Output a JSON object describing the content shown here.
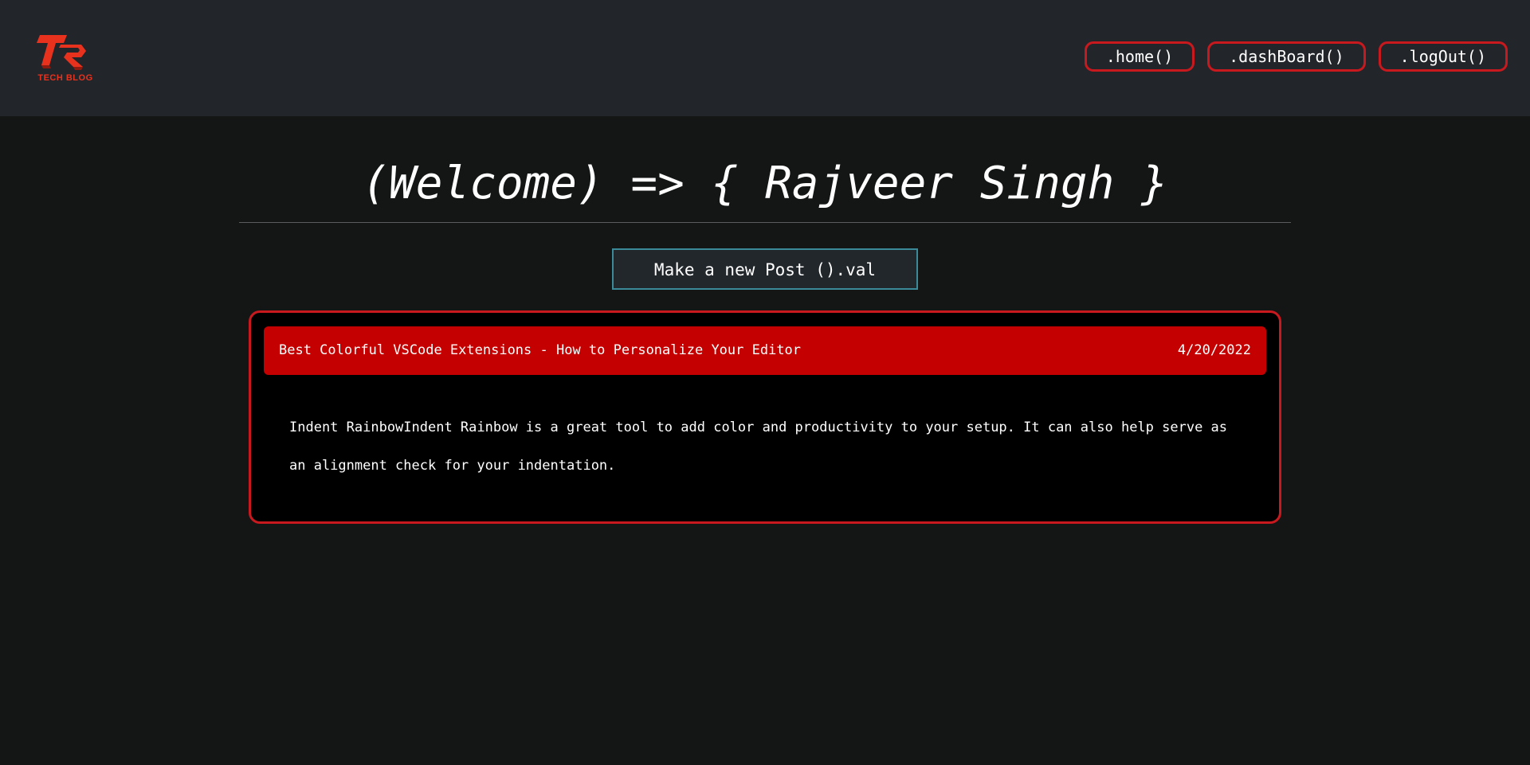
{
  "brand": {
    "logo_text": "TECH BLOG",
    "accent_color": "#c8191e"
  },
  "nav": {
    "items": [
      {
        "label": ".home()"
      },
      {
        "label": ".dashBoard()"
      },
      {
        "label": ".logOut()"
      }
    ]
  },
  "main": {
    "welcome": "(Welcome) => { Rajveer Singh }",
    "new_post_label": "Make a new Post ().val"
  },
  "posts": [
    {
      "title": "Best Colorful VSCode Extensions - How to Personalize Your Editor",
      "date": "4/20/2022",
      "body": "Indent RainbowIndent Rainbow is a great tool to add color and productivity to your setup. It can also help serve as an alignment check for your indentation."
    }
  ]
}
